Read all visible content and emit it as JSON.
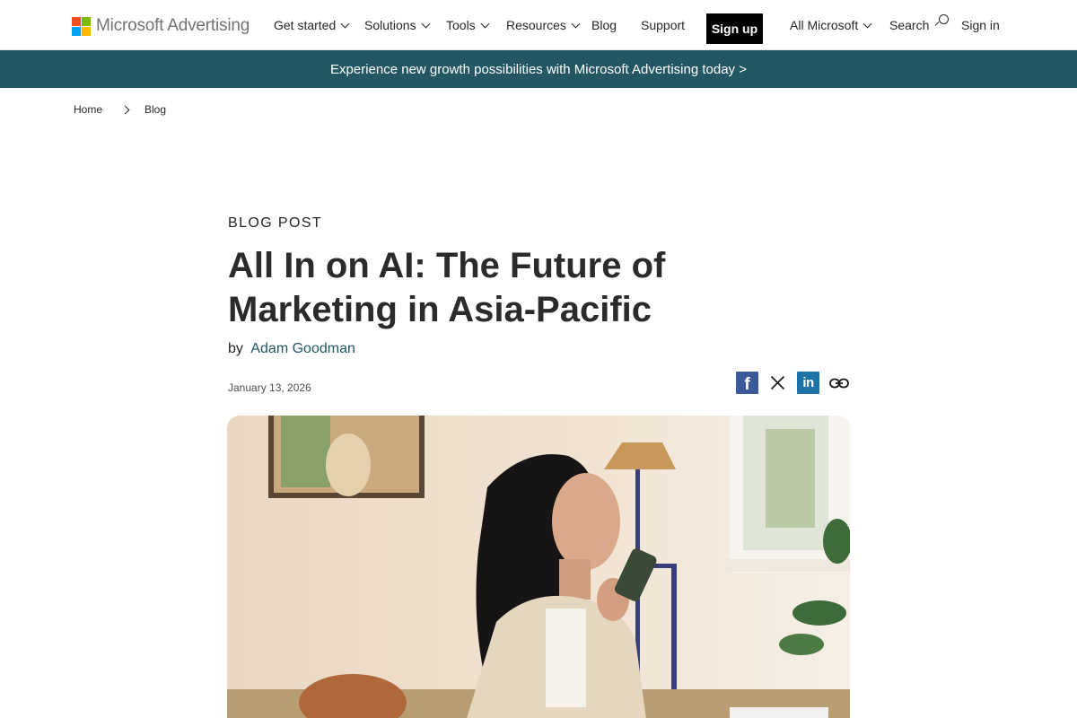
{
  "header": {
    "logo_text": "Microsoft Advertising",
    "nav": [
      {
        "label": "Get started",
        "has_dropdown": true
      },
      {
        "label": "Solutions",
        "has_dropdown": true
      },
      {
        "label": "Tools",
        "has_dropdown": true
      },
      {
        "label": "Resources",
        "has_dropdown": true
      },
      {
        "label": "Blog",
        "has_dropdown": false
      },
      {
        "label": "Support",
        "has_dropdown": false
      }
    ],
    "signup_label": "Sign up",
    "all_microsoft_label": "All Microsoft",
    "search_label": "Search",
    "signin_label": "Sign in"
  },
  "banner": {
    "text": "Experience new growth possibilities with Microsoft Advertising today >",
    "color": "#225763"
  },
  "breadcrumb": [
    "Home",
    "Blog"
  ],
  "article": {
    "eyebrow": "BLOG POST",
    "title": "All In on AI: The Future of Marketing in Asia-Pacific",
    "by_label": "by",
    "author": "Adam Goodman",
    "date": "January 13, 2026",
    "share": [
      {
        "icon": "facebook-icon",
        "glyph": "f"
      },
      {
        "icon": "x-icon",
        "glyph": "𝕏"
      },
      {
        "icon": "linkedin-icon",
        "glyph": "in"
      },
      {
        "icon": "link-icon",
        "glyph": ""
      }
    ]
  },
  "colors": {
    "accent": "#225763",
    "ms_red": "#f25022",
    "ms_green": "#7fba00",
    "ms_blue": "#00a4ef",
    "ms_yellow": "#ffb900"
  }
}
